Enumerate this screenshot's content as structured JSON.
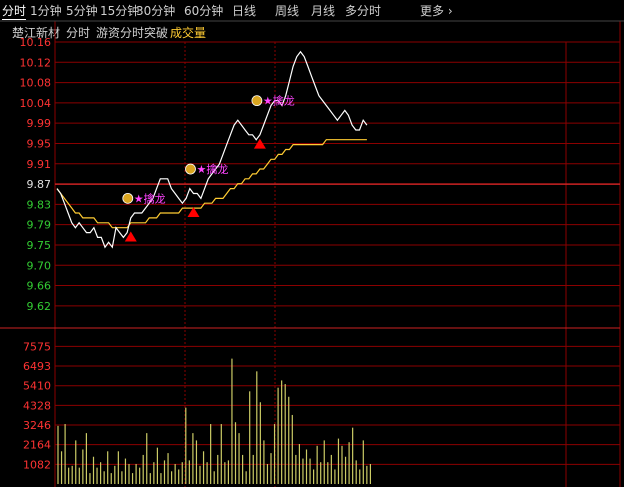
{
  "tabs": [
    {
      "label": "分时",
      "active": true
    },
    {
      "label": "1分钟"
    },
    {
      "label": "5分钟"
    },
    {
      "label": "15分钟"
    },
    {
      "label": "30分钟"
    },
    {
      "label": "60分钟"
    },
    {
      "label": "日线"
    },
    {
      "label": "周线"
    },
    {
      "label": "月线"
    },
    {
      "label": "多分时"
    }
  ],
  "more_label": "更多",
  "header": {
    "stock_name": "楚江新材",
    "mode": "分时",
    "indicator": "游资分时突破",
    "volume_label": "成交量"
  },
  "colors": {
    "background": "#000000",
    "grid": "#8b0000",
    "axis_up": "#ff3333",
    "axis_down": "#33cc33",
    "axis_neutral": "#e0e0e0",
    "price_line": "#ffffff",
    "avg_line": "#ffcc33",
    "volume": "#cccc66",
    "signal_triangle": "#ff0000",
    "signal_text": "#ff44ff"
  },
  "chart_data": {
    "type": "line",
    "price_axis": {
      "ticks": [
        "10.16",
        "10.12",
        "10.08",
        "10.04",
        "9.99",
        "9.95",
        "9.91",
        "9.87",
        "9.83",
        "9.79",
        "9.75",
        "9.70",
        "9.66",
        "9.62"
      ],
      "ylim": [
        9.6,
        10.16
      ],
      "prev_close": 9.87
    },
    "volume_axis": {
      "ticks": [
        "7575",
        "6493",
        "5410",
        "4328",
        "3246",
        "2164",
        "1082"
      ],
      "ylim": [
        0,
        8200
      ]
    },
    "price": [
      9.86,
      9.85,
      9.83,
      9.81,
      9.79,
      9.78,
      9.79,
      9.78,
      9.77,
      9.77,
      9.78,
      9.76,
      9.76,
      9.74,
      9.75,
      9.74,
      9.78,
      9.77,
      9.76,
      9.77,
      9.8,
      9.81,
      9.81,
      9.81,
      9.82,
      9.83,
      9.84,
      9.86,
      9.88,
      9.88,
      9.88,
      9.86,
      9.85,
      9.84,
      9.83,
      9.84,
      9.86,
      9.85,
      9.85,
      9.84,
      9.86,
      9.88,
      9.89,
      9.9,
      9.91,
      9.93,
      9.95,
      9.97,
      9.99,
      10.0,
      9.99,
      9.98,
      9.97,
      9.97,
      9.96,
      9.97,
      9.99,
      10.01,
      10.03,
      10.04,
      10.04,
      10.03,
      10.05,
      10.08,
      10.11,
      10.13,
      10.14,
      10.13,
      10.11,
      10.09,
      10.07,
      10.05,
      10.04,
      10.03,
      10.02,
      10.01,
      10.0,
      10.01,
      10.02,
      10.01,
      9.99,
      9.98,
      9.98,
      10.0,
      9.99
    ],
    "avg_price": [
      9.86,
      9.85,
      9.84,
      9.83,
      9.82,
      9.81,
      9.81,
      9.8,
      9.8,
      9.8,
      9.8,
      9.79,
      9.79,
      9.79,
      9.79,
      9.78,
      9.78,
      9.78,
      9.78,
      9.78,
      9.79,
      9.79,
      9.79,
      9.79,
      9.79,
      9.8,
      9.8,
      9.8,
      9.81,
      9.81,
      9.81,
      9.81,
      9.81,
      9.81,
      9.82,
      9.82,
      9.82,
      9.82,
      9.82,
      9.82,
      9.83,
      9.83,
      9.83,
      9.84,
      9.84,
      9.84,
      9.85,
      9.86,
      9.86,
      9.87,
      9.87,
      9.88,
      9.88,
      9.89,
      9.89,
      9.9,
      9.9,
      9.91,
      9.92,
      9.92,
      9.93,
      9.93,
      9.94,
      9.94,
      9.95,
      9.95,
      9.95,
      9.95,
      9.95,
      9.95,
      9.95,
      9.95,
      9.95,
      9.96,
      9.96,
      9.96,
      9.96,
      9.96,
      9.96,
      9.96,
      9.96,
      9.96,
      9.96,
      9.96,
      9.96
    ],
    "volume": [
      3200,
      1800,
      3300,
      900,
      1000,
      2400,
      900,
      1900,
      2800,
      600,
      1500,
      900,
      1200,
      700,
      1800,
      600,
      1000,
      1800,
      700,
      1400,
      1100,
      600,
      1100,
      900,
      1600,
      2800,
      600,
      1200,
      2000,
      600,
      1300,
      1700,
      700,
      1100,
      800,
      1200,
      4200,
      1300,
      2800,
      2400,
      1000,
      1800,
      1200,
      3300,
      700,
      1600,
      3300,
      1200,
      1300,
      6900,
      3400,
      2800,
      1600,
      700,
      5100,
      1600,
      6200,
      4500,
      2400,
      1100,
      1700,
      3300,
      5300,
      5700,
      5500,
      4800,
      3800,
      1600,
      2200,
      1400,
      1900,
      1400,
      800,
      2100,
      1200,
      2400,
      1200,
      1600,
      800,
      2500,
      2100,
      1500,
      2300,
      3100,
      1300,
      800,
      2400,
      1000,
      1100
    ],
    "signals": [
      {
        "type": "buy_triangle",
        "index": 20,
        "price": 9.76
      },
      {
        "type": "buy_triangle",
        "index": 37,
        "price": 9.81
      },
      {
        "type": "buy_triangle",
        "index": 55,
        "price": 9.95
      },
      {
        "type": "label",
        "index": 20,
        "price": 9.84,
        "text": "★擒龙"
      },
      {
        "type": "label",
        "index": 37,
        "price": 9.9,
        "text": "★擒龙"
      },
      {
        "type": "label",
        "index": 55,
        "price": 10.04,
        "text": "★擒龙"
      }
    ]
  }
}
